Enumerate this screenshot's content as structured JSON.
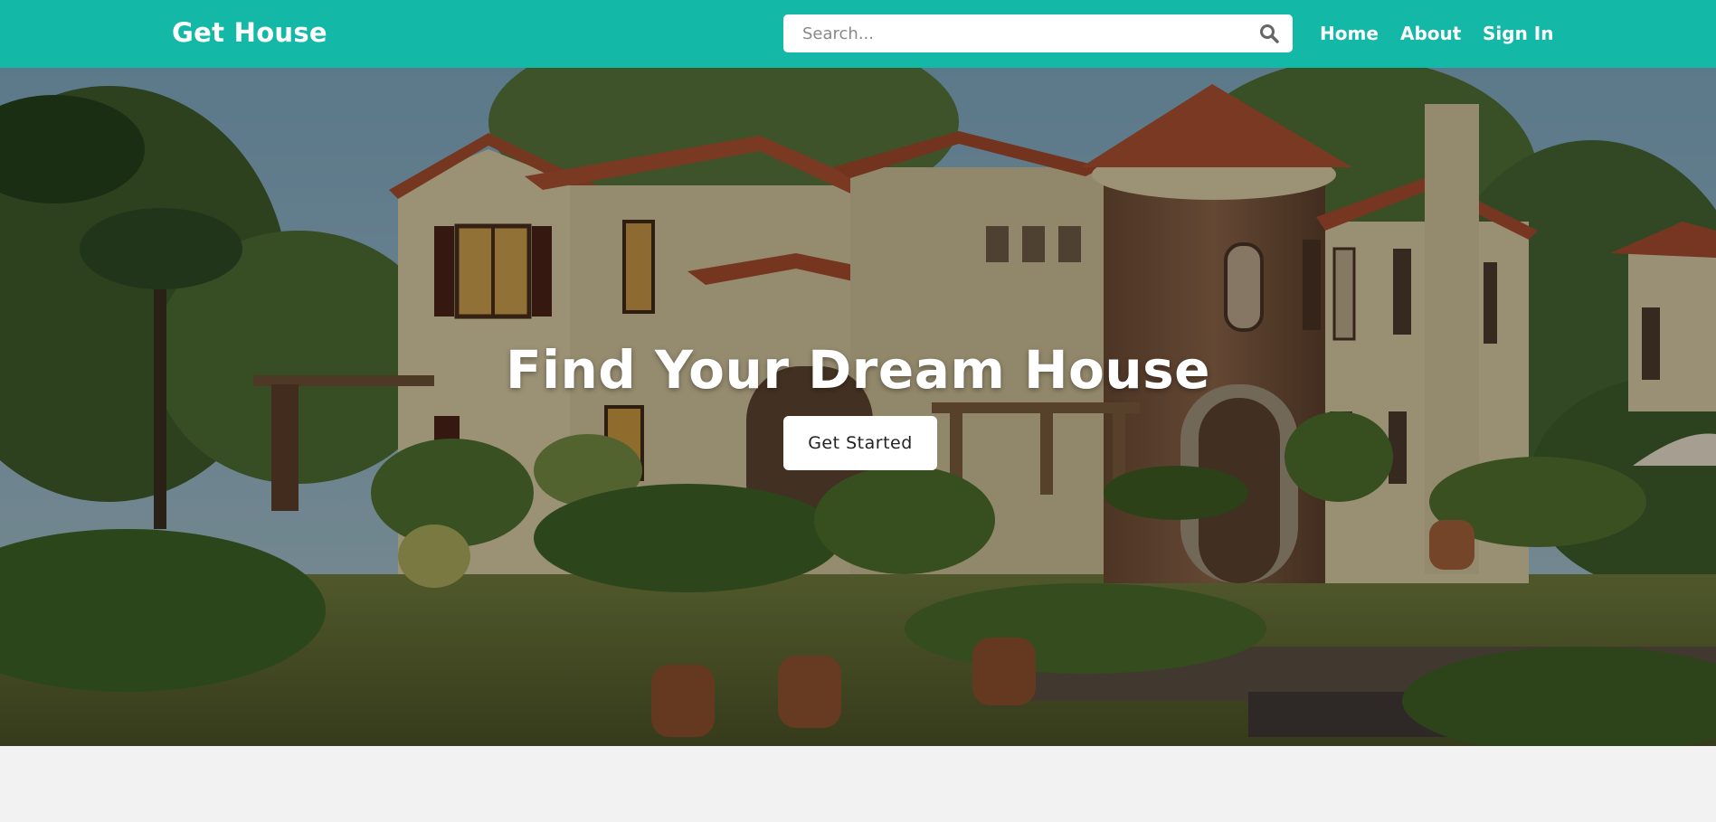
{
  "header": {
    "brand": "Get House",
    "search": {
      "placeholder": "Search...",
      "value": ""
    },
    "nav": [
      {
        "label": "Home"
      },
      {
        "label": "About"
      },
      {
        "label": "Sign In"
      }
    ]
  },
  "hero": {
    "title": "Find Your Dream House",
    "cta_label": "Get Started"
  },
  "icons": {
    "search": "search-icon"
  },
  "colors": {
    "navbar": "#14b8a6",
    "page_background": "#f2f2f2",
    "button_background": "#ffffff"
  }
}
